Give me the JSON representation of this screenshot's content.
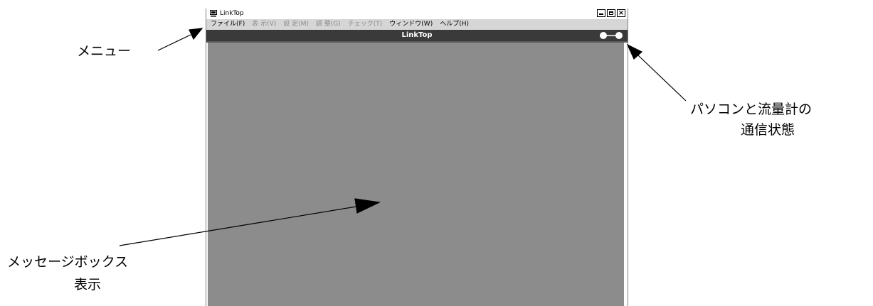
{
  "window": {
    "title": "LinkTop",
    "header_title": "LinkTop"
  },
  "menu": {
    "items": [
      {
        "label": "ファイル(F)",
        "state": "enabled"
      },
      {
        "label": "表 示(V)",
        "state": "disabled"
      },
      {
        "label": "設 定(M)",
        "state": "disabled"
      },
      {
        "label": "調 整(G)",
        "state": "disabled"
      },
      {
        "label": "チェック(T)",
        "state": "disabled"
      },
      {
        "label": "ウィンドウ(W)",
        "state": "enabled"
      },
      {
        "label": "ヘルプ(H)",
        "state": "enabled"
      }
    ]
  },
  "annotations": {
    "menu": "メニュー",
    "connection_line1": "パソコンと流量計の",
    "connection_line2": "通信状態",
    "message_line1": "メッセージボックス",
    "message_line2": "表示"
  },
  "colors": {
    "menubar": "#d6d6d6",
    "header": "#3a3a3a",
    "message_area": "#8c8c8c"
  }
}
